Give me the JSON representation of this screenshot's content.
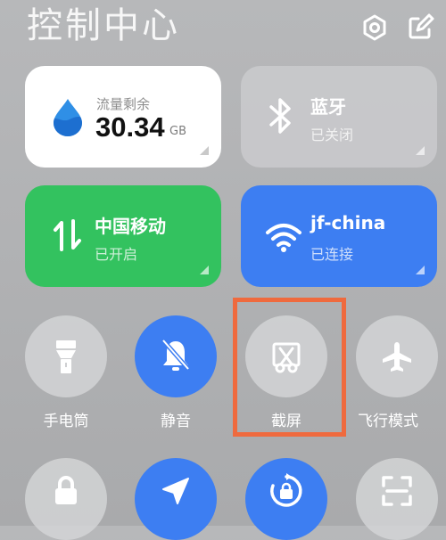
{
  "header": {
    "title": "控制中心"
  },
  "cards": {
    "data_usage": {
      "label": "流量剩余",
      "value": "30.34",
      "unit": "GB"
    },
    "bluetooth": {
      "label": "蓝牙",
      "status": "已关闭"
    },
    "mobile_data": {
      "label": "中国移动",
      "status": "已开启"
    },
    "wifi": {
      "label": "jf-china",
      "status": "已连接"
    }
  },
  "tiles": {
    "flashlight": "手电筒",
    "mute": "静音",
    "screenshot": "截屏",
    "airplane": "飞行模式"
  },
  "colors": {
    "active_blue": "#3d7ef2",
    "mobile_green": "#33c25f",
    "highlight_orange": "#ef6a3e"
  }
}
